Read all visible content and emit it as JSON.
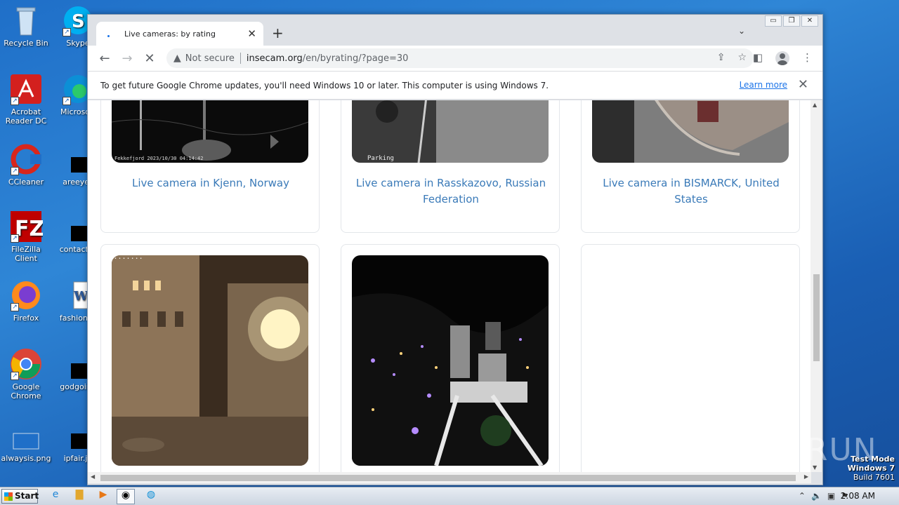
{
  "desktop": {
    "icons_left": [
      {
        "label": "Recycle Bin"
      },
      {
        "label": "Acrobat Reader DC"
      },
      {
        "label": "CCleaner"
      },
      {
        "label": "FileZilla Client"
      },
      {
        "label": "Firefox"
      },
      {
        "label": "Google Chrome"
      },
      {
        "label": "alwaysis.png"
      }
    ],
    "icons_right": [
      {
        "label": "Skype"
      },
      {
        "label": "Microsoft"
      },
      {
        "label": "areeyes"
      },
      {
        "label": "contactfri"
      },
      {
        "label": "fashionsy"
      },
      {
        "label": "godgoing"
      },
      {
        "label": "ipfair.jp"
      }
    ]
  },
  "browser": {
    "tab_title": "Live cameras: by rating",
    "tab_close": "✕",
    "new_tab": "+",
    "tab_menu": "⌄",
    "not_secure": "Not secure",
    "url_host": "insecam.org",
    "url_path": "/en/byrating/?page=30",
    "infobar_text": "To get future Google Chrome updates, you'll need Windows 10 or later. This computer is using Windows 7.",
    "learn_more": "Learn more"
  },
  "page": {
    "cameras": [
      {
        "label": "Live camera in Kjenn, Norway",
        "stamp": "Fekkefjord 2023/10/30 04:14:42"
      },
      {
        "label": "Live camera in Rasskazovo, Russian Federation",
        "stamp": "Parking"
      },
      {
        "label": "Live camera in BISMARCK, United States"
      },
      {
        "label": ""
      },
      {
        "label": ""
      },
      {
        "label": ""
      }
    ]
  },
  "taskbar": {
    "start_label": "Start",
    "clock": "2:08 AM"
  },
  "watermark": {
    "line1": "Test Mode",
    "line2": "Windows 7",
    "line3": "Build 7601",
    "brand": "ANY RUN"
  }
}
